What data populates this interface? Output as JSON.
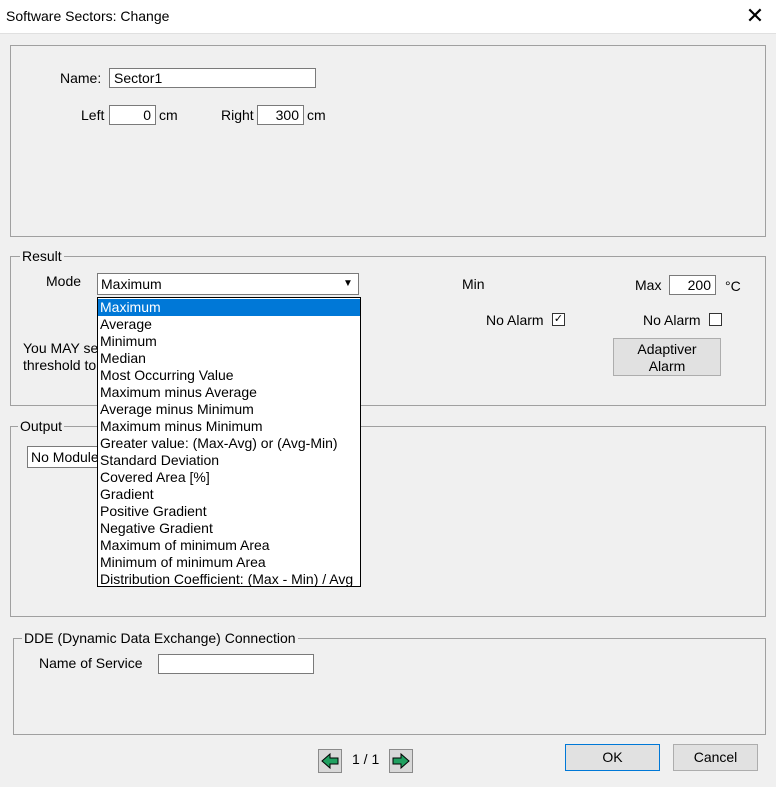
{
  "window": {
    "title": "Software Sectors: Change"
  },
  "sector": {
    "name_label": "Name:",
    "name_value": "Sector1",
    "left_label": "Left",
    "left_value": "0",
    "left_unit": "cm",
    "right_label": "Right",
    "right_value": "300",
    "right_unit": "cm"
  },
  "result": {
    "legend": "Result",
    "mode_label": "Mode",
    "mode_selected": "Maximum",
    "min_label": "Min",
    "max_label": "Max",
    "max_value": "200",
    "max_unit": "°C",
    "no_alarm_left": "No Alarm",
    "no_alarm_left_checked": true,
    "no_alarm_right": "No Alarm",
    "no_alarm_right_checked": false,
    "hint_line1": "You MAY se",
    "hint_line2": "threshold to",
    "adaptive_alarm": [
      "Adaptiver",
      "Alarm"
    ],
    "mode_options": [
      "Maximum",
      "Average",
      "Minimum",
      "Median",
      "Most Occurring Value",
      "Maximum minus Average",
      "Average minus Minimum",
      "Maximum minus Minimum",
      "Greater value: (Max-Avg) or (Avg-Min)",
      "Standard Deviation",
      "Covered Area [%]",
      "Gradient",
      "Positive Gradient",
      "Negative Gradient",
      "Maximum of minimum Area",
      "Minimum of minimum Area",
      "Distribution Coefficient: (Max - Min) / Avg"
    ]
  },
  "output": {
    "legend": "Output",
    "module_value": "No Module"
  },
  "dde": {
    "legend": "DDE (Dynamic Data Exchange) Connection",
    "service_label": "Name of Service",
    "service_value": ""
  },
  "footer": {
    "page": "1 / 1",
    "ok": "OK",
    "cancel": "Cancel"
  },
  "icons": {
    "close": "close-icon",
    "prev": "arrow-left-icon",
    "next": "arrow-right-icon",
    "check": "check-icon"
  }
}
